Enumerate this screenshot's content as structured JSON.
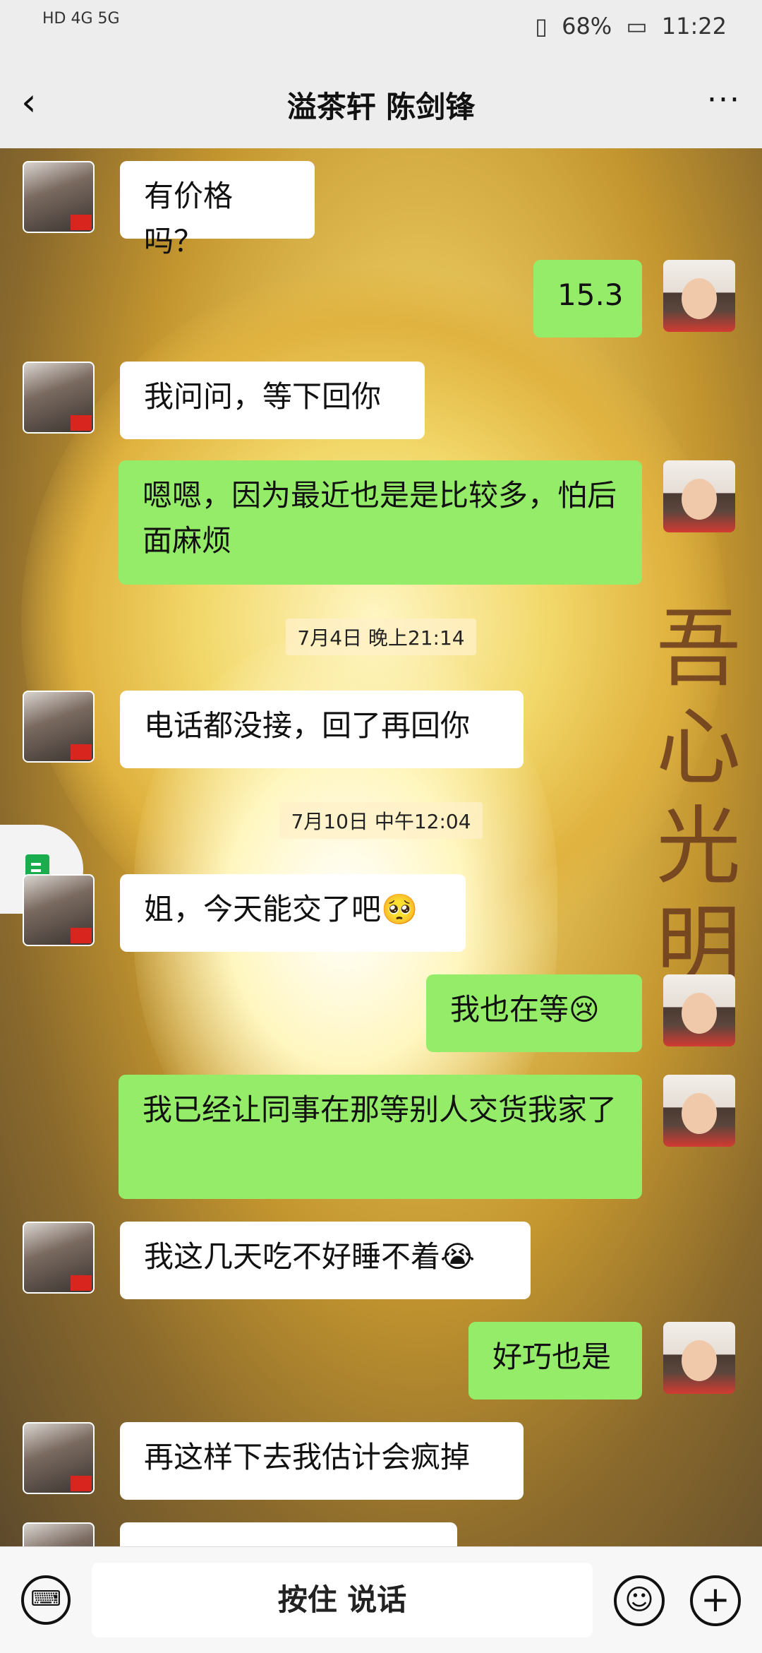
{
  "status": {
    "left": "HD 4G 5G",
    "battery": "68%",
    "time": "11:22"
  },
  "header": {
    "back_icon": "chevron-left-icon",
    "title": "溢茶轩  陈剑锋",
    "more_icon": "more-icon"
  },
  "background": {
    "calligraphy": [
      "吾",
      "心",
      "光",
      "明"
    ]
  },
  "messages": [
    {
      "side": "in",
      "text": "有价格吗？"
    },
    {
      "side": "out",
      "text": "15.3"
    },
    {
      "side": "in",
      "text": "我问问，等下回你"
    },
    {
      "side": "out",
      "text": "嗯嗯，因为最近也是是比较多，怕后面麻烦"
    },
    {
      "time": "7月4日 晚上21:14"
    },
    {
      "side": "in",
      "text": "电话都没接，回了再回你"
    },
    {
      "time": "7月10日 中午12:04"
    },
    {
      "side": "in",
      "text": "姐，今天能交了吧🥺"
    },
    {
      "side": "out",
      "text": "我也在等😢"
    },
    {
      "side": "out",
      "text": "我已经让同事在那等别人交货我家了"
    },
    {
      "side": "in",
      "text": "我这几天吃不好睡不着😭"
    },
    {
      "side": "out",
      "text": "好巧也是"
    },
    {
      "side": "in",
      "text": "再这样下去我估计会疯掉"
    }
  ],
  "bottom": {
    "voice_label": "按住 说话"
  }
}
